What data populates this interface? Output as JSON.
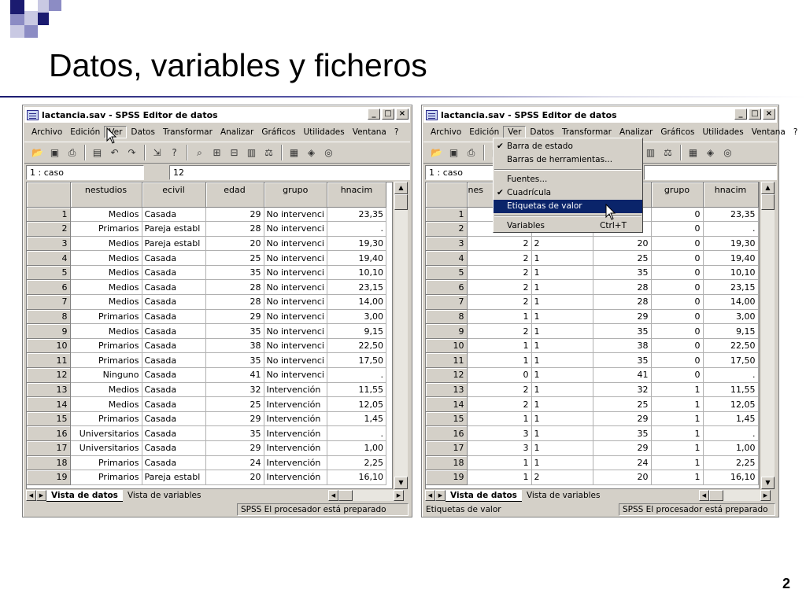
{
  "slide": {
    "title": "Datos, variables y ficheros",
    "page_number": "2",
    "accent_colors": [
      "#1b1b70",
      "#8c8cc4",
      "#c9c9e3"
    ]
  },
  "window_title": "lactancia.sav - SPSS Editor de datos",
  "window_buttons": [
    "_",
    "□",
    "×"
  ],
  "menu": [
    "Archivo",
    "Edición",
    "Ver",
    "Datos",
    "Transformar",
    "Analizar",
    "Gráficos",
    "Utilidades",
    "Ventana",
    "?"
  ],
  "toolbar_icons": [
    "open-icon",
    "save-icon",
    "print-icon",
    "dialog-recall-icon",
    "undo-icon",
    "redo-icon",
    "goto-case-icon",
    "variables-icon",
    "find-icon",
    "insert-case-icon",
    "insert-variable-icon",
    "split-file-icon",
    "weight-cases-icon",
    "select-cases-icon",
    "value-labels-icon",
    "use-sets-icon"
  ],
  "cell_ref": "1 : caso",
  "cell_value": "12",
  "columns": [
    "nestudios",
    "ecivil",
    "edad",
    "grupo",
    "hnacim"
  ],
  "rows_labels": [
    [
      "1",
      "Medios",
      "Casada",
      "29",
      "No intervenci",
      "23,35"
    ],
    [
      "2",
      "Primarios",
      "Pareja establ",
      "28",
      "No intervenci",
      "."
    ],
    [
      "3",
      "Medios",
      "Pareja establ",
      "20",
      "No intervenci",
      "19,30"
    ],
    [
      "4",
      "Medios",
      "Casada",
      "25",
      "No intervenci",
      "19,40"
    ],
    [
      "5",
      "Medios",
      "Casada",
      "35",
      "No intervenci",
      "10,10"
    ],
    [
      "6",
      "Medios",
      "Casada",
      "28",
      "No intervenci",
      "23,15"
    ],
    [
      "7",
      "Medios",
      "Casada",
      "28",
      "No intervenci",
      "14,00"
    ],
    [
      "8",
      "Primarios",
      "Casada",
      "29",
      "No intervenci",
      "3,00"
    ],
    [
      "9",
      "Medios",
      "Casada",
      "35",
      "No intervenci",
      "9,15"
    ],
    [
      "10",
      "Primarios",
      "Casada",
      "38",
      "No intervenci",
      "22,50"
    ],
    [
      "11",
      "Primarios",
      "Casada",
      "35",
      "No intervenci",
      "17,50"
    ],
    [
      "12",
      "Ninguno",
      "Casada",
      "41",
      "No intervenci",
      "."
    ],
    [
      "13",
      "Medios",
      "Casada",
      "32",
      "Intervención",
      "11,55"
    ],
    [
      "14",
      "Medios",
      "Casada",
      "25",
      "Intervención",
      "12,05"
    ],
    [
      "15",
      "Primarios",
      "Casada",
      "29",
      "Intervención",
      "1,45"
    ],
    [
      "16",
      "Universitarios",
      "Casada",
      "35",
      "Intervención",
      "."
    ],
    [
      "17",
      "Universitarios",
      "Casada",
      "29",
      "Intervención",
      "1,00"
    ],
    [
      "18",
      "Primarios",
      "Casada",
      "24",
      "Intervención",
      "2,25"
    ],
    [
      "19",
      "Primarios",
      "Pareja establ",
      "20",
      "Intervención",
      "16,10"
    ]
  ],
  "rows_values": [
    [
      "1",
      "",
      "",
      "",
      "0",
      "23,35"
    ],
    [
      "2",
      "",
      "",
      "",
      "0",
      "."
    ],
    [
      "3",
      "2",
      "2",
      "20",
      "0",
      "19,30"
    ],
    [
      "4",
      "2",
      "1",
      "25",
      "0",
      "19,40"
    ],
    [
      "5",
      "2",
      "1",
      "35",
      "0",
      "10,10"
    ],
    [
      "6",
      "2",
      "1",
      "28",
      "0",
      "23,15"
    ],
    [
      "7",
      "2",
      "1",
      "28",
      "0",
      "14,00"
    ],
    [
      "8",
      "1",
      "1",
      "29",
      "0",
      "3,00"
    ],
    [
      "9",
      "2",
      "1",
      "35",
      "0",
      "9,15"
    ],
    [
      "10",
      "1",
      "1",
      "38",
      "0",
      "22,50"
    ],
    [
      "11",
      "1",
      "1",
      "35",
      "0",
      "17,50"
    ],
    [
      "12",
      "0",
      "1",
      "41",
      "0",
      "."
    ],
    [
      "13",
      "2",
      "1",
      "32",
      "1",
      "11,55"
    ],
    [
      "14",
      "2",
      "1",
      "25",
      "1",
      "12,05"
    ],
    [
      "15",
      "1",
      "1",
      "29",
      "1",
      "1,45"
    ],
    [
      "16",
      "3",
      "1",
      "35",
      "1",
      "."
    ],
    [
      "17",
      "3",
      "1",
      "29",
      "1",
      "1,00"
    ],
    [
      "18",
      "1",
      "1",
      "24",
      "1",
      "2,25"
    ],
    [
      "19",
      "1",
      "2",
      "20",
      "1",
      "16,10"
    ]
  ],
  "right_partial_header": "nes",
  "tabs": [
    "Vista de datos",
    "Vista de variables"
  ],
  "status_text": "SPSS El procesador  está preparado",
  "status_left_right": "Etiquetas de valor",
  "ver_menu": {
    "items": [
      {
        "label": "Barra de estado",
        "checked": true
      },
      {
        "label": "Barras de herramientas...",
        "checked": false
      },
      {
        "separator": true
      },
      {
        "label": "Fuentes...",
        "checked": false
      },
      {
        "label": "Cuadrícula",
        "checked": true
      },
      {
        "label": "Etiquetas de valor",
        "checked": false,
        "highlighted": true
      },
      {
        "separator": true
      },
      {
        "label": "Variables",
        "checked": false,
        "shortcut": "Ctrl+T"
      }
    ]
  }
}
